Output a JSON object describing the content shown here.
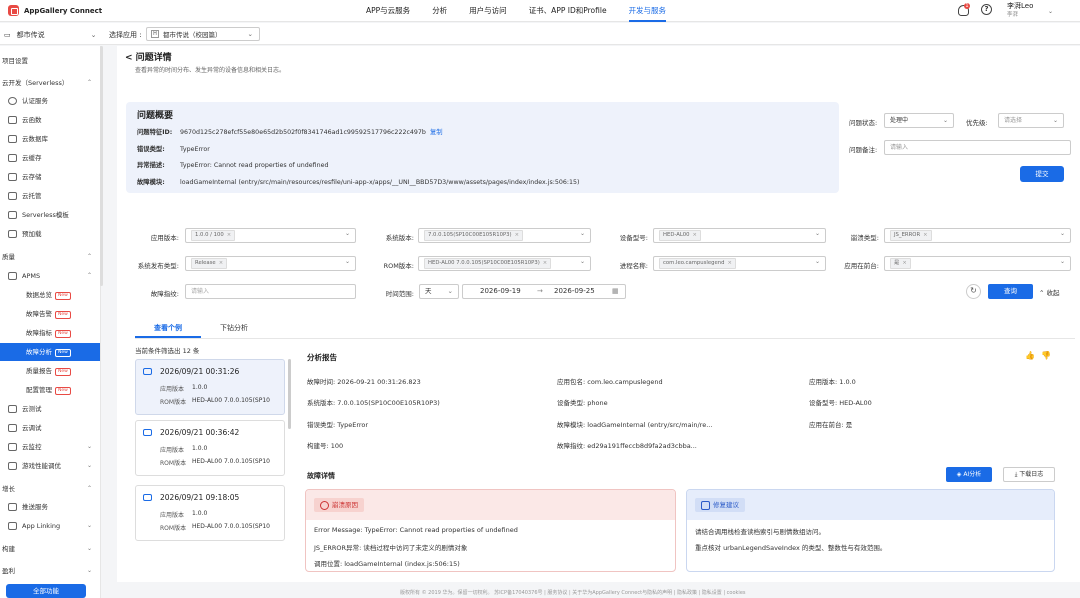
{
  "topbar": {
    "logo": "AppGallery Connect",
    "nav": [
      "APP与云服务",
      "分析",
      "用户与访问",
      "证书、APP ID和Profile",
      "开发与服务"
    ],
    "notify_count": "1",
    "help": "?",
    "user_name": "李湃Leo",
    "user_sub": "李湃"
  },
  "subbar": {
    "project": "都市传说",
    "app_label": "选择应用 :",
    "app_value": "都市传说（校园篇）",
    "app_icon": "H"
  },
  "sidebar": {
    "items": [
      {
        "label": "项目设置",
        "type": "group"
      },
      {
        "label": "云开发（Serverless）",
        "type": "group"
      },
      {
        "label": "认证服务",
        "type": "item"
      },
      {
        "label": "云函数",
        "type": "item"
      },
      {
        "label": "云数据库",
        "type": "item"
      },
      {
        "label": "云缓存",
        "type": "item"
      },
      {
        "label": "云存储",
        "type": "item"
      },
      {
        "label": "云托管",
        "type": "item"
      },
      {
        "label": "Serverless模板",
        "type": "item"
      },
      {
        "label": "预加载",
        "type": "item"
      },
      {
        "label": "质量",
        "type": "group"
      },
      {
        "label": "APMS",
        "type": "item"
      },
      {
        "label": "数据总览",
        "type": "sub",
        "new": "New"
      },
      {
        "label": "故障告警",
        "type": "sub",
        "new": "New"
      },
      {
        "label": "故障指标",
        "type": "sub",
        "new": "New"
      },
      {
        "label": "故障分析",
        "type": "sub",
        "new": "New"
      },
      {
        "label": "质量报告",
        "type": "sub",
        "new": "New"
      },
      {
        "label": "配置管理",
        "type": "sub",
        "new": "New"
      },
      {
        "label": "云测试",
        "type": "item"
      },
      {
        "label": "云调试",
        "type": "item"
      },
      {
        "label": "云监控",
        "type": "item"
      },
      {
        "label": "游戏性能调优",
        "type": "item"
      },
      {
        "label": "增长",
        "type": "group"
      },
      {
        "label": "推送服务",
        "type": "item"
      },
      {
        "label": "App Linking",
        "type": "item"
      },
      {
        "label": "构建",
        "type": "group"
      },
      {
        "label": "盈利",
        "type": "group"
      }
    ],
    "all_functions": "全部功能"
  },
  "page": {
    "back_title": "< 问题详情",
    "subtitle": "查看异常的时间分布、发生异常的设备信息和相关日志。"
  },
  "overview": {
    "title": "问题概要",
    "rows": [
      {
        "k": "问题特征ID:",
        "v": "9670d125c278efcf55e80e65d2b502f0f8341746ad1c99592517796c222c497b",
        "copy": "复制"
      },
      {
        "k": "错误类型:",
        "v": "TypeError"
      },
      {
        "k": "异常描述:",
        "v": "TypeError: Cannot read properties of undefined"
      },
      {
        "k": "故障模块:",
        "v": "loadGameInternal (entry/src/main/resources/resfile/uni-app-x/apps/__UNI__BBD57D3/www/assets/pages/index/index.js:506:15)"
      }
    ]
  },
  "right_form": {
    "status_label": "问题状态:",
    "status_value": "处理中",
    "priority_label": "优先级:",
    "priority_placeholder": "请选择",
    "remark_label": "问题备注:",
    "remark_placeholder": "请输入",
    "submit": "提交"
  },
  "filters": {
    "app_version": {
      "label": "应用版本:",
      "tag": "1.0.0 / 100"
    },
    "os_version": {
      "label": "系统版本:",
      "tag": "7.0.0.105(SP10C00E105R10P3)"
    },
    "device_model": {
      "label": "设备型号:",
      "tag": "HED-AL00"
    },
    "crash_type": {
      "label": "崩溃类型:",
      "tag": "JS_ERROR"
    },
    "os_release_type": {
      "label": "系统发布类型:",
      "tag": "Release"
    },
    "rom_version": {
      "label": "ROM版本:",
      "tag": "HED-AL00 7.0.0.105(SP10C00E105R10P3)"
    },
    "process_name": {
      "label": "进程名称:",
      "tag": "com.leo.campuslegend"
    },
    "foreground": {
      "label": "应用在前台:",
      "tag": "是"
    },
    "fingerprint": {
      "label": "故障指纹:",
      "placeholder": "请输入"
    },
    "time_range": {
      "label": "时间范围:",
      "unit": "天",
      "start": "2026-09-19",
      "arrow": "→",
      "end": "2026-09-25"
    },
    "query": "查询",
    "collapse": "收起"
  },
  "tabs": [
    "查看个例",
    "下钻分析"
  ],
  "list": {
    "header": "当前条件筛选出 12 条",
    "cards": [
      {
        "time": "2026/09/21 00:31:26",
        "app_label": "应用版本",
        "app": "1.0.0",
        "rom_label": "ROM版本",
        "rom": "HED-AL00 7.0.0.105(SP10"
      },
      {
        "time": "2026/09/21 00:36:42",
        "app_label": "应用版本",
        "app": "1.0.0",
        "rom_label": "ROM版本",
        "rom": "HED-AL00 7.0.0.105(SP10"
      },
      {
        "time": "2026/09/21 09:18:05",
        "app_label": "应用版本",
        "app": "1.0.0",
        "rom_label": "ROM版本",
        "rom": "HED-AL00 7.0.0.105(SP10"
      }
    ]
  },
  "report": {
    "title": "分析报告",
    "fields": [
      {
        "k": "故障时间:",
        "v": "2026-09-21 00:31:26.823"
      },
      {
        "k": "应用包名:",
        "v": "com.leo.campuslegend"
      },
      {
        "k": "应用版本:",
        "v": "1.0.0"
      },
      {
        "k": "系统版本:",
        "v": "7.0.0.105(SP10C00E105R10P3)"
      },
      {
        "k": "设备类型:",
        "v": "phone"
      },
      {
        "k": "设备型号:",
        "v": "HED-AL00"
      },
      {
        "k": "错误类型:",
        "v": "TypeError"
      },
      {
        "k": "故障模块:",
        "v": "loadGameInternal (entry/src/main/re..."
      },
      {
        "k": "应用在前台:",
        "v": "是"
      },
      {
        "k": "构建号:",
        "v": "100"
      },
      {
        "k": "故障指纹:",
        "v": "ed29a191ffeccb8d9fa2ad3cbba..."
      }
    ],
    "detail_title": "故障详情",
    "ai_button": "AI分析",
    "log_button": "下载日志",
    "cause": {
      "badge": "崩溃原因",
      "lines": [
        "Error Message: TypeError: Cannot read properties of undefined",
        "JS_ERROR异常: 读档过程中访问了未定义的剧情对象",
        "调用位置: loadGameInternal (index.js:506:15)"
      ]
    },
    "fix": {
      "badge": "修复建议",
      "lines": [
        "请结合调用栈检查读档索引与剧情数组访问。",
        "重点核对 urbanLegendSaveIndex 的类型、整数性与有效范围。"
      ]
    }
  },
  "footer": "版权所有 © 2019 华为。保留一切权利。 苏ICP备17040376号 | 服务协议 | 关于华为AppGallery Connect与隐私的声明 | 隐私政策 | 隐私设置 | cookies"
}
